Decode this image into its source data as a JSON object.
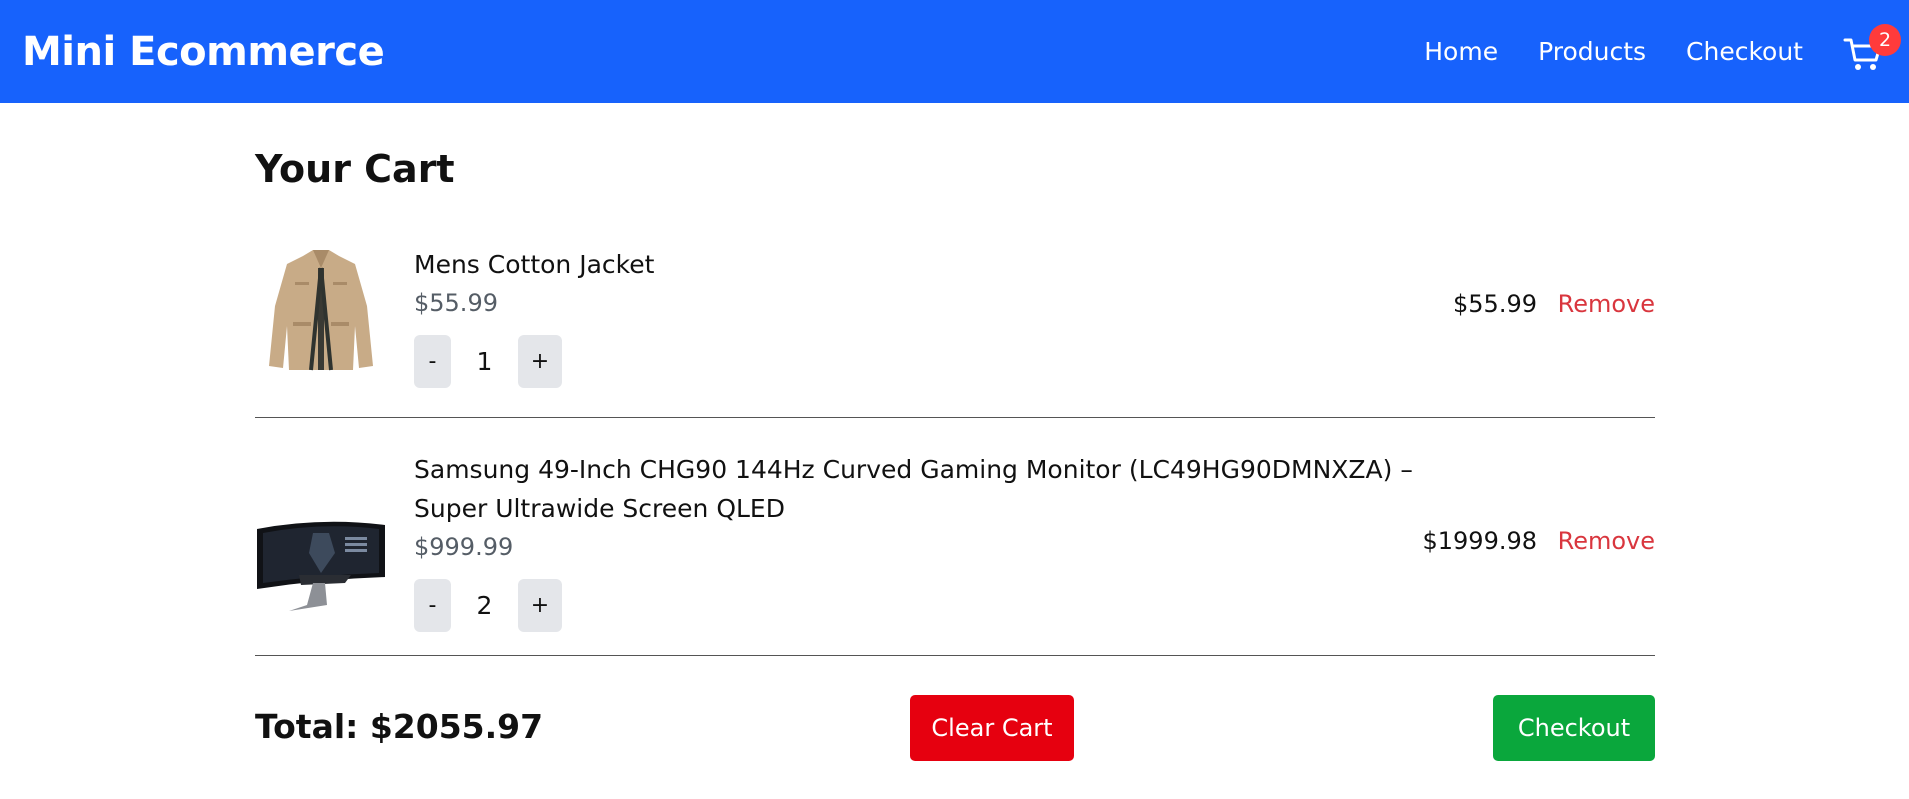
{
  "nav": {
    "brand": "Mini Ecommerce",
    "links": [
      "Home",
      "Products",
      "Checkout"
    ],
    "cart_count": "2",
    "accent": "#1762fc"
  },
  "cart": {
    "title": "Your Cart",
    "items": [
      {
        "name": "Mens Cotton Jacket",
        "unit_price": "$55.99",
        "quantity": "1",
        "line_total": "$55.99",
        "image": "jacket-photo"
      },
      {
        "name": "Samsung 49-Inch CHG90 144Hz Curved Gaming Monitor (LC49HG90DMNXZA) – Super Ultrawide Screen QLED",
        "unit_price": "$999.99",
        "quantity": "2",
        "line_total": "$1999.98",
        "image": "monitor-photo"
      }
    ],
    "minus_label": "-",
    "plus_label": "+",
    "remove_label": "Remove",
    "total_label": "Total: $2055.97",
    "clear_label": "Clear Cart",
    "checkout_label": "Checkout"
  },
  "colors": {
    "remove": "#d9363e",
    "clear_button": "#e6000f",
    "checkout_button": "#0aa73c",
    "badge": "#ff3b3b"
  }
}
